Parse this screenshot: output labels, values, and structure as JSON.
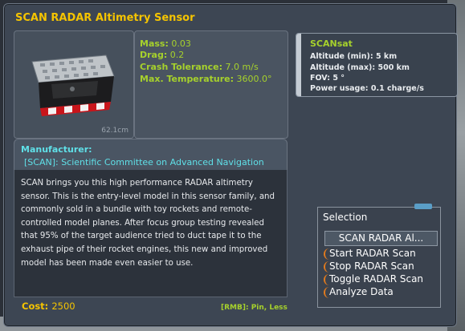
{
  "window": {
    "title": "SCAN RADAR Altimetry Sensor"
  },
  "part_view": {
    "size_label": "62.1cm"
  },
  "stats": [
    {
      "label": "Mass:",
      "value": "0.03"
    },
    {
      "label": "Drag:",
      "value": "0.2"
    },
    {
      "label": "Crash Tolerance:",
      "value": "7.0 m/s"
    },
    {
      "label": "Max. Temperature:",
      "value": "3600.0°"
    }
  ],
  "manufacturer": {
    "label": "Manufacturer:",
    "value": "[SCAN]: Scientific Committee on Advanced Navigation"
  },
  "description": "SCAN brings you this high performance RADAR altimetry sensor. This is the entry-level model in this sensor family, and commonly sold in a bundle with toy rockets and remote-controlled model planes. After focus group testing revealed that 95% of the target audience tried to duct tape it to the exhaust pipe of their rocket engines, this new and improved model has been made even easier to use.",
  "cost": {
    "label": "Cost:",
    "value": "2500"
  },
  "rmb_hint": "[RMB]: Pin, Less",
  "module": {
    "title": "SCANsat",
    "lines": [
      "Altitude (min): 5 km",
      "Altitude (max): 500 km",
      "FOV: 5 °",
      "Power usage: 0.1 charge/s"
    ]
  },
  "selection": {
    "title": "Selection",
    "part_name": "SCAN RADAR Al...",
    "actions": [
      "Start RADAR Scan",
      "Stop RADAR Scan",
      "Toggle RADAR Scan",
      "Analyze Data"
    ]
  },
  "colors": {
    "title": "#f5c400",
    "stats": "#a6d12c",
    "manufacturer": "#5fe0e8",
    "bracket": "#e07a1e"
  }
}
